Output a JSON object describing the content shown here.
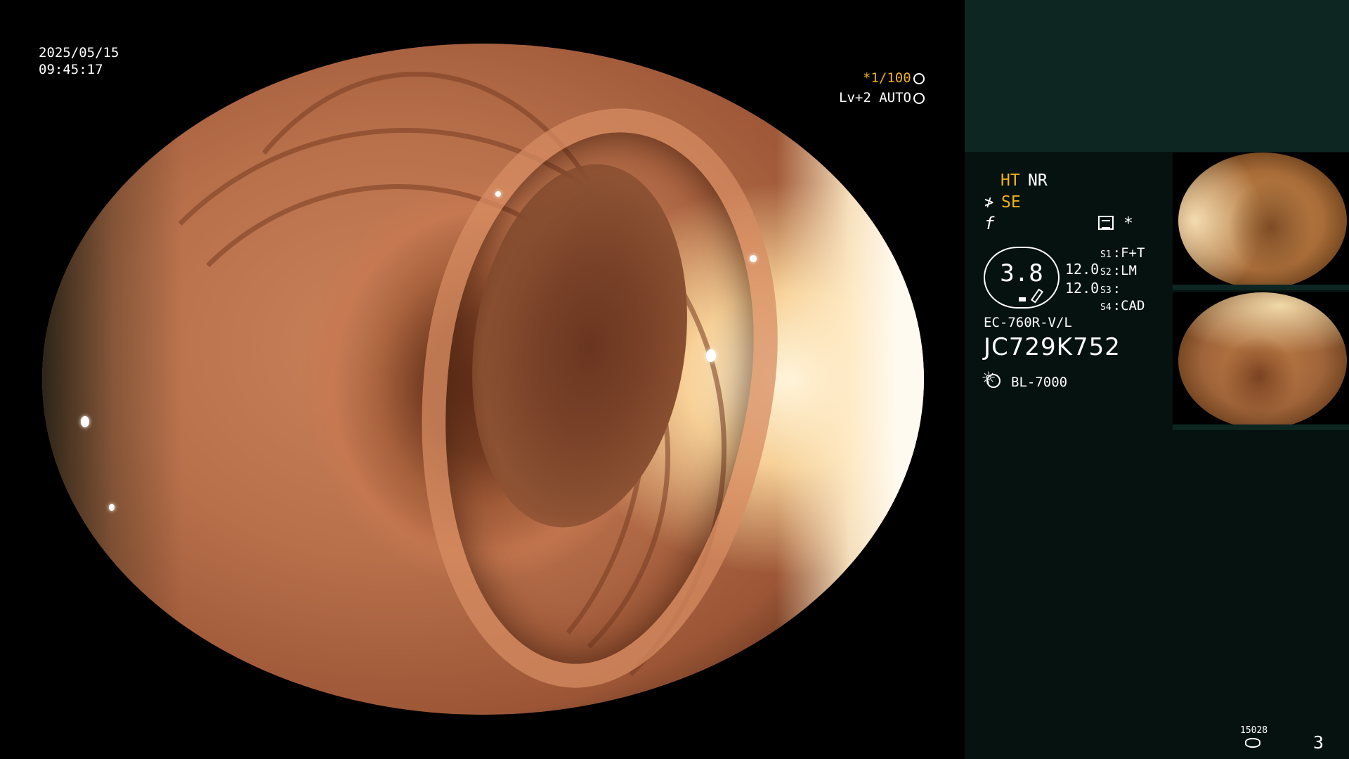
{
  "overlay": {
    "date": "2025/05/15",
    "time": "09:45:17",
    "shutter": "*1/100",
    "shutter_icon": "aperture-icon",
    "level": "Lv+2 AUTO",
    "level_icon": "iris-icon"
  },
  "panel": {
    "ht": "HT",
    "nr": "NR",
    "se_icon": "≯",
    "se": "SE",
    "f_icon": "f",
    "star": "*",
    "gauge_value": "3.8",
    "dist1": "12.0",
    "dist2": "12.0",
    "slots": [
      {
        "key": "S1",
        "value": "F+T"
      },
      {
        "key": "S2",
        "value": "LM"
      },
      {
        "key": "S3",
        "value": ""
      },
      {
        "key": "S4",
        "value": "CAD"
      }
    ],
    "scope_model": "EC-760R-V/L",
    "serial": "JC729K752",
    "light_source": "BL-7000"
  },
  "footer": {
    "image_count": "15028",
    "page": "3"
  },
  "colors": {
    "accent_yellow": "#f0b21a",
    "panel_bg": "#06120f",
    "panel_top_bg": "#0d2622"
  }
}
